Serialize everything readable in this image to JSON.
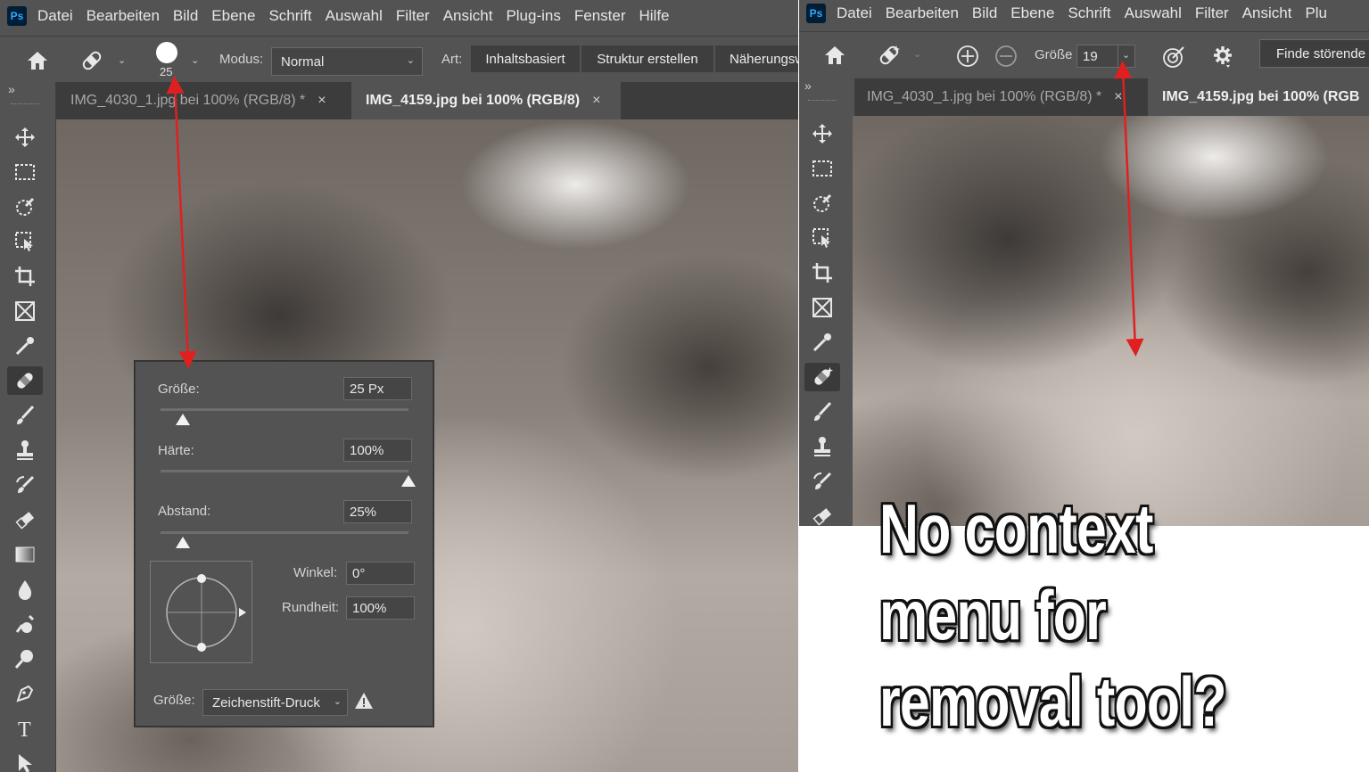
{
  "left": {
    "menu": [
      "Datei",
      "Bearbeiten",
      "Bild",
      "Ebene",
      "Schrift",
      "Auswahl",
      "Filter",
      "Ansicht",
      "Plug-ins",
      "Fenster",
      "Hilfe"
    ],
    "options": {
      "brush_size": "25",
      "mode_label": "Modus:",
      "mode_value": "Normal",
      "type_label": "Art:",
      "type_buttons": [
        "Inhaltsbasiert",
        "Struktur erstellen",
        "Näherungsw"
      ]
    },
    "tabs": [
      {
        "label": "IMG_4030_1.jpg bei 100% (RGB/8) *",
        "close": "×"
      },
      {
        "label": "IMG_4159.jpg bei 100% (RGB/8)",
        "close": "×"
      }
    ],
    "toolbar_collapse": "»",
    "brush_popup": {
      "size_label": "Größe:",
      "size_value": "25 Px",
      "size_slider": 0.09,
      "hardness_label": "Härte:",
      "hardness_value": "100%",
      "hardness_slider": 1.0,
      "spacing_label": "Abstand:",
      "spacing_value": "25%",
      "spacing_slider": 0.09,
      "angle_label": "Winkel:",
      "angle_value": "0°",
      "roundness_label": "Rundheit:",
      "roundness_value": "100%",
      "size_control_label": "Größe:",
      "size_control_value": "Zeichenstift-Druck",
      "warning_icon": "warning-icon"
    }
  },
  "right": {
    "menu": [
      "Datei",
      "Bearbeiten",
      "Bild",
      "Ebene",
      "Schrift",
      "Auswahl",
      "Filter",
      "Ansicht",
      "Plu"
    ],
    "options": {
      "size_label": "Größe",
      "size_value": "19",
      "find_button": "Finde störende"
    },
    "tabs": [
      {
        "label": "IMG_4030_1.jpg bei 100% (RGB/8) *",
        "close": "×"
      },
      {
        "label": "IMG_4159.jpg bei 100% (RGB",
        "close": ""
      }
    ],
    "toolbar_collapse": "»"
  },
  "caption": {
    "lines": [
      "No context",
      "menu for",
      "removal tool?"
    ]
  },
  "colors": {
    "ui_bg": "#535353",
    "arrow": "#e02020",
    "ps_blue": "#31a8ff"
  }
}
